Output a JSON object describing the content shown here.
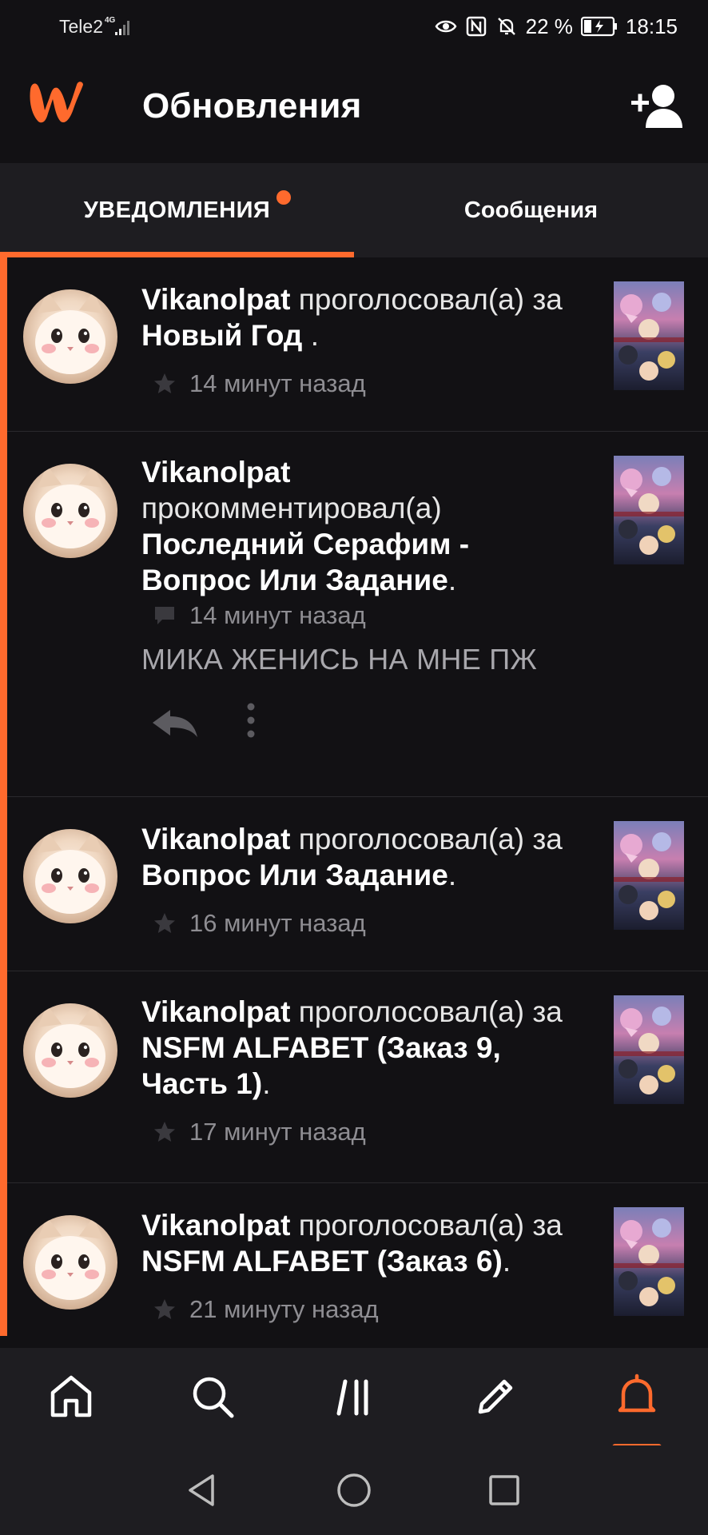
{
  "status_bar": {
    "carrier": "Tele2",
    "network": "4G",
    "battery_percent": "22 %",
    "time": "18:15"
  },
  "header": {
    "title": "Обновления",
    "logo_icon": "wattpad-logo",
    "add_user_icon": "add-user-icon"
  },
  "tabs": [
    {
      "label": "УВЕДОМЛЕНИЯ",
      "active": true,
      "has_badge": true
    },
    {
      "label": "Сообщения",
      "active": false,
      "has_badge": false
    }
  ],
  "notifications": [
    {
      "user": "Vikanolpat",
      "action": " проголосовал(а) за ",
      "target": "Новый Год",
      "suffix": " .",
      "icon": "star-icon",
      "time": "14 минут назад"
    },
    {
      "user": "Vikanolpat",
      "action": " прокомментировал(а) ",
      "target": "Последний Серафим - Вопрос Или Задание",
      "suffix": ".",
      "icon": "comment-icon",
      "time": "14 минут назад",
      "comment": "МИКА ЖЕНИСЬ НА МНЕ ПЖ"
    },
    {
      "user": "Vikanolpat",
      "action": " проголосовал(а) за ",
      "target": "Вопрос Или Задание",
      "suffix": ".",
      "icon": "star-icon",
      "time": "16 минут назад"
    },
    {
      "user": "Vikanolpat",
      "action": " проголосовал(а) за ",
      "target": "NSFM ALFABET (Заказ 9, Часть 1)",
      "suffix": ".",
      "icon": "star-icon",
      "time": "17 минут назад"
    },
    {
      "user": "Vikanolpat",
      "action": " проголосовал(а) за ",
      "target": "NSFM ALFABET (Заказ 6)",
      "suffix": ".",
      "icon": "star-icon",
      "time": "21 минуту назад"
    }
  ],
  "bottom_nav": [
    {
      "icon": "home-icon",
      "active": false
    },
    {
      "icon": "search-icon",
      "active": false
    },
    {
      "icon": "library-icon",
      "active": false
    },
    {
      "icon": "write-icon",
      "active": false
    },
    {
      "icon": "bell-icon",
      "active": true
    }
  ],
  "colors": {
    "accent": "#ff6a2d",
    "background": "#121114",
    "surface": "#1e1d21"
  }
}
